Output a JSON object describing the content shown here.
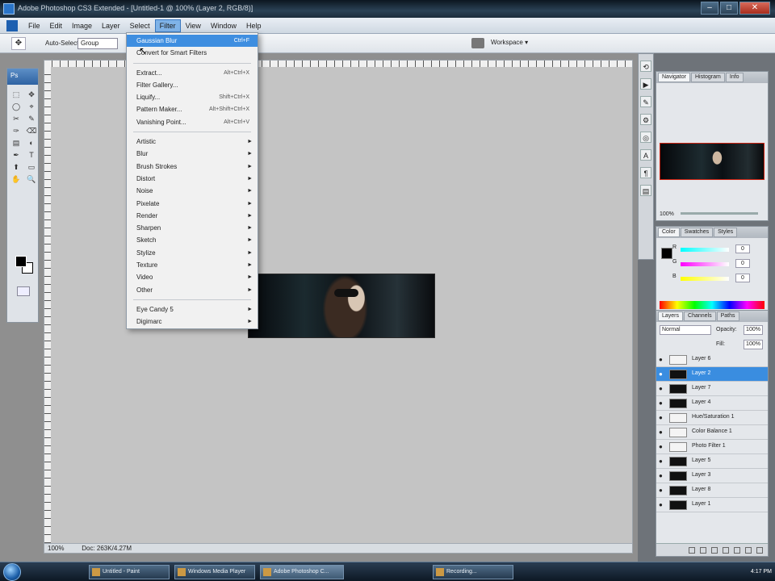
{
  "window": {
    "title": "Adobe Photoshop CS3 Extended - [Untitled-1 @ 100% (Layer 2, RGB/8)]"
  },
  "menubar": {
    "items": [
      "File",
      "Edit",
      "Image",
      "Layer",
      "Select",
      "Filter",
      "View",
      "Window",
      "Help"
    ],
    "active": "Filter"
  },
  "options": {
    "tool": "✥",
    "label": "Auto-Select:",
    "select": "Group",
    "workspace": "Workspace ▾"
  },
  "filter_menu": {
    "items": [
      {
        "label": "Gaussian Blur",
        "shortcut": "Ctrl+F",
        "highlighted": true
      },
      {
        "label": "Convert for Smart Filters",
        "shortcut": ""
      },
      {
        "sep": true
      },
      {
        "label": "Extract...",
        "shortcut": "Alt+Ctrl+X"
      },
      {
        "label": "Filter Gallery...",
        "shortcut": ""
      },
      {
        "label": "Liquify...",
        "shortcut": "Shift+Ctrl+X"
      },
      {
        "label": "Pattern Maker...",
        "shortcut": "Alt+Shift+Ctrl+X"
      },
      {
        "label": "Vanishing Point...",
        "shortcut": "Alt+Ctrl+V"
      },
      {
        "sep": true
      },
      {
        "label": "Artistic",
        "submenu": true
      },
      {
        "label": "Blur",
        "submenu": true
      },
      {
        "label": "Brush Strokes",
        "submenu": true
      },
      {
        "label": "Distort",
        "submenu": true
      },
      {
        "label": "Noise",
        "submenu": true
      },
      {
        "label": "Pixelate",
        "submenu": true
      },
      {
        "label": "Render",
        "submenu": true
      },
      {
        "label": "Sharpen",
        "submenu": true
      },
      {
        "label": "Sketch",
        "submenu": true
      },
      {
        "label": "Stylize",
        "submenu": true
      },
      {
        "label": "Texture",
        "submenu": true
      },
      {
        "label": "Video",
        "submenu": true
      },
      {
        "label": "Other",
        "submenu": true
      },
      {
        "sep": true
      },
      {
        "label": "Eye Candy 5",
        "submenu": true
      },
      {
        "label": "Digimarc",
        "submenu": true
      }
    ]
  },
  "toolbox": {
    "title": "Ps",
    "tools": [
      "⬚",
      "✥",
      "◯",
      "⌖",
      "✂",
      "✎",
      "✑",
      "⌫",
      "▤",
      "◐",
      "✒",
      "T",
      "⬆",
      "▭",
      "✋",
      "🔍"
    ]
  },
  "navigator": {
    "tabs": [
      "Navigator",
      "Histogram",
      "Info"
    ],
    "zoom": "100%"
  },
  "color_panel": {
    "tabs": [
      "Color",
      "Swatches",
      "Styles"
    ],
    "channels": [
      {
        "name": "R",
        "value": "0",
        "gradient": "linear-gradient(90deg,#0ff,#fff)"
      },
      {
        "name": "G",
        "value": "0",
        "gradient": "linear-gradient(90deg,#f0f,#fff)"
      },
      {
        "name": "B",
        "value": "0",
        "gradient": "linear-gradient(90deg,#ff0,#fff)"
      }
    ]
  },
  "layers_panel": {
    "tabs": [
      "Layers",
      "Channels",
      "Paths"
    ],
    "blend_mode": "Normal",
    "opacity_label": "Opacity:",
    "opacity": "100%",
    "fill_label": "Fill:",
    "fill": "100%",
    "layers": [
      {
        "name": "Layer 6",
        "thumb": "light"
      },
      {
        "name": "Layer 2",
        "thumb": "dark",
        "selected": true
      },
      {
        "name": "Layer 7",
        "thumb": "dark"
      },
      {
        "name": "Layer 4",
        "thumb": "dark"
      },
      {
        "name": "Hue/Saturation 1",
        "thumb": "light"
      },
      {
        "name": "Color Balance 1",
        "thumb": "light"
      },
      {
        "name": "Photo Filter 1",
        "thumb": "light"
      },
      {
        "name": "Layer 5",
        "thumb": "dark"
      },
      {
        "name": "Layer 3",
        "thumb": "dark"
      },
      {
        "name": "Layer 8",
        "thumb": "dark"
      },
      {
        "name": "Layer 1",
        "thumb": "dark"
      }
    ]
  },
  "document": {
    "zoom": "100%",
    "status": "Doc: 263K/4.27M"
  },
  "taskbar": {
    "buttons": [
      {
        "label": "Untitled - Paint"
      },
      {
        "label": "Windows Media Player"
      },
      {
        "label": "Adobe Photoshop C...",
        "active": true
      },
      {
        "label": "Recording..."
      }
    ],
    "clock": "4:17 PM"
  }
}
